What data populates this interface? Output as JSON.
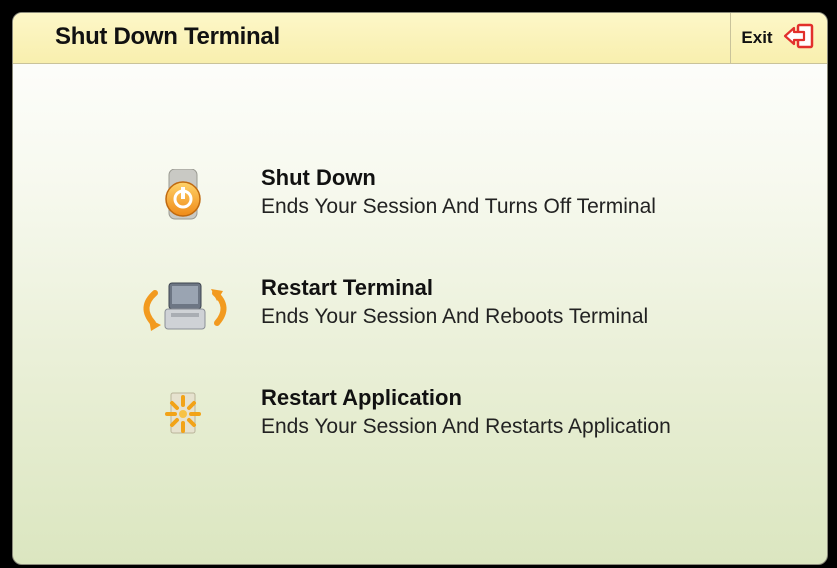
{
  "window": {
    "title": "Shut Down Terminal",
    "exit_label": "Exit"
  },
  "options": [
    {
      "label": "Shut Down",
      "description": "Ends Your Session And Turns Off Terminal",
      "icon": "power-icon"
    },
    {
      "label": "Restart Terminal",
      "description": "Ends Your Session And Reboots Terminal",
      "icon": "restart-terminal-icon"
    },
    {
      "label": "Restart Application",
      "description": "Ends Your Session And Restarts Application",
      "icon": "restart-application-icon"
    }
  ],
  "colors": {
    "titlebar": "#f8efae",
    "accent_orange": "#f29a1f",
    "exit_red": "#e2302c"
  }
}
